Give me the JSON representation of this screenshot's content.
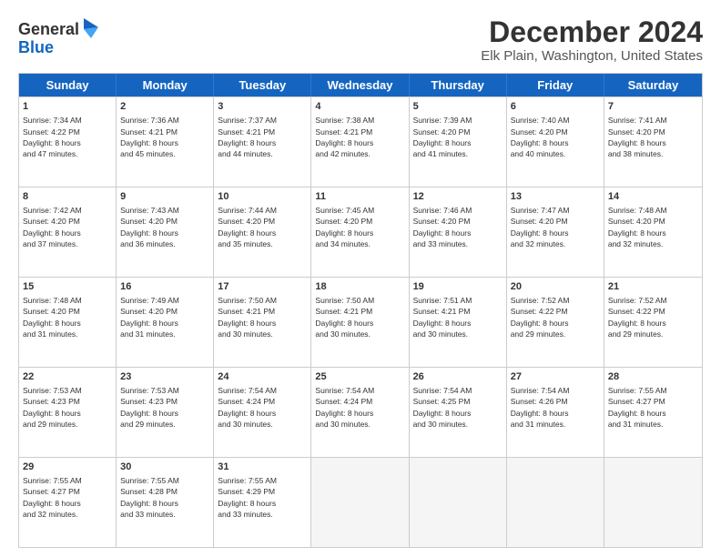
{
  "header": {
    "logo_general": "General",
    "logo_blue": "Blue",
    "title": "December 2024",
    "subtitle": "Elk Plain, Washington, United States"
  },
  "days_of_week": [
    "Sunday",
    "Monday",
    "Tuesday",
    "Wednesday",
    "Thursday",
    "Friday",
    "Saturday"
  ],
  "rows": [
    [
      {
        "day": "1",
        "lines": [
          "Sunrise: 7:34 AM",
          "Sunset: 4:22 PM",
          "Daylight: 8 hours",
          "and 47 minutes."
        ]
      },
      {
        "day": "2",
        "lines": [
          "Sunrise: 7:36 AM",
          "Sunset: 4:21 PM",
          "Daylight: 8 hours",
          "and 45 minutes."
        ]
      },
      {
        "day": "3",
        "lines": [
          "Sunrise: 7:37 AM",
          "Sunset: 4:21 PM",
          "Daylight: 8 hours",
          "and 44 minutes."
        ]
      },
      {
        "day": "4",
        "lines": [
          "Sunrise: 7:38 AM",
          "Sunset: 4:21 PM",
          "Daylight: 8 hours",
          "and 42 minutes."
        ]
      },
      {
        "day": "5",
        "lines": [
          "Sunrise: 7:39 AM",
          "Sunset: 4:20 PM",
          "Daylight: 8 hours",
          "and 41 minutes."
        ]
      },
      {
        "day": "6",
        "lines": [
          "Sunrise: 7:40 AM",
          "Sunset: 4:20 PM",
          "Daylight: 8 hours",
          "and 40 minutes."
        ]
      },
      {
        "day": "7",
        "lines": [
          "Sunrise: 7:41 AM",
          "Sunset: 4:20 PM",
          "Daylight: 8 hours",
          "and 38 minutes."
        ]
      }
    ],
    [
      {
        "day": "8",
        "lines": [
          "Sunrise: 7:42 AM",
          "Sunset: 4:20 PM",
          "Daylight: 8 hours",
          "and 37 minutes."
        ]
      },
      {
        "day": "9",
        "lines": [
          "Sunrise: 7:43 AM",
          "Sunset: 4:20 PM",
          "Daylight: 8 hours",
          "and 36 minutes."
        ]
      },
      {
        "day": "10",
        "lines": [
          "Sunrise: 7:44 AM",
          "Sunset: 4:20 PM",
          "Daylight: 8 hours",
          "and 35 minutes."
        ]
      },
      {
        "day": "11",
        "lines": [
          "Sunrise: 7:45 AM",
          "Sunset: 4:20 PM",
          "Daylight: 8 hours",
          "and 34 minutes."
        ]
      },
      {
        "day": "12",
        "lines": [
          "Sunrise: 7:46 AM",
          "Sunset: 4:20 PM",
          "Daylight: 8 hours",
          "and 33 minutes."
        ]
      },
      {
        "day": "13",
        "lines": [
          "Sunrise: 7:47 AM",
          "Sunset: 4:20 PM",
          "Daylight: 8 hours",
          "and 32 minutes."
        ]
      },
      {
        "day": "14",
        "lines": [
          "Sunrise: 7:48 AM",
          "Sunset: 4:20 PM",
          "Daylight: 8 hours",
          "and 32 minutes."
        ]
      }
    ],
    [
      {
        "day": "15",
        "lines": [
          "Sunrise: 7:48 AM",
          "Sunset: 4:20 PM",
          "Daylight: 8 hours",
          "and 31 minutes."
        ]
      },
      {
        "day": "16",
        "lines": [
          "Sunrise: 7:49 AM",
          "Sunset: 4:20 PM",
          "Daylight: 8 hours",
          "and 31 minutes."
        ]
      },
      {
        "day": "17",
        "lines": [
          "Sunrise: 7:50 AM",
          "Sunset: 4:21 PM",
          "Daylight: 8 hours",
          "and 30 minutes."
        ]
      },
      {
        "day": "18",
        "lines": [
          "Sunrise: 7:50 AM",
          "Sunset: 4:21 PM",
          "Daylight: 8 hours",
          "and 30 minutes."
        ]
      },
      {
        "day": "19",
        "lines": [
          "Sunrise: 7:51 AM",
          "Sunset: 4:21 PM",
          "Daylight: 8 hours",
          "and 30 minutes."
        ]
      },
      {
        "day": "20",
        "lines": [
          "Sunrise: 7:52 AM",
          "Sunset: 4:22 PM",
          "Daylight: 8 hours",
          "and 29 minutes."
        ]
      },
      {
        "day": "21",
        "lines": [
          "Sunrise: 7:52 AM",
          "Sunset: 4:22 PM",
          "Daylight: 8 hours",
          "and 29 minutes."
        ]
      }
    ],
    [
      {
        "day": "22",
        "lines": [
          "Sunrise: 7:53 AM",
          "Sunset: 4:23 PM",
          "Daylight: 8 hours",
          "and 29 minutes."
        ]
      },
      {
        "day": "23",
        "lines": [
          "Sunrise: 7:53 AM",
          "Sunset: 4:23 PM",
          "Daylight: 8 hours",
          "and 29 minutes."
        ]
      },
      {
        "day": "24",
        "lines": [
          "Sunrise: 7:54 AM",
          "Sunset: 4:24 PM",
          "Daylight: 8 hours",
          "and 30 minutes."
        ]
      },
      {
        "day": "25",
        "lines": [
          "Sunrise: 7:54 AM",
          "Sunset: 4:24 PM",
          "Daylight: 8 hours",
          "and 30 minutes."
        ]
      },
      {
        "day": "26",
        "lines": [
          "Sunrise: 7:54 AM",
          "Sunset: 4:25 PM",
          "Daylight: 8 hours",
          "and 30 minutes."
        ]
      },
      {
        "day": "27",
        "lines": [
          "Sunrise: 7:54 AM",
          "Sunset: 4:26 PM",
          "Daylight: 8 hours",
          "and 31 minutes."
        ]
      },
      {
        "day": "28",
        "lines": [
          "Sunrise: 7:55 AM",
          "Sunset: 4:27 PM",
          "Daylight: 8 hours",
          "and 31 minutes."
        ]
      }
    ],
    [
      {
        "day": "29",
        "lines": [
          "Sunrise: 7:55 AM",
          "Sunset: 4:27 PM",
          "Daylight: 8 hours",
          "and 32 minutes."
        ]
      },
      {
        "day": "30",
        "lines": [
          "Sunrise: 7:55 AM",
          "Sunset: 4:28 PM",
          "Daylight: 8 hours",
          "and 33 minutes."
        ]
      },
      {
        "day": "31",
        "lines": [
          "Sunrise: 7:55 AM",
          "Sunset: 4:29 PM",
          "Daylight: 8 hours",
          "and 33 minutes."
        ]
      },
      {
        "day": "",
        "lines": []
      },
      {
        "day": "",
        "lines": []
      },
      {
        "day": "",
        "lines": []
      },
      {
        "day": "",
        "lines": []
      }
    ]
  ]
}
